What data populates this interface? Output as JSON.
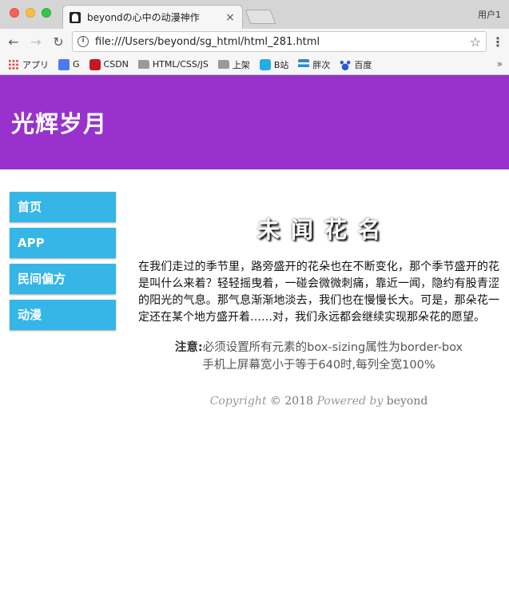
{
  "browser": {
    "tab_title": "beyondの心中の动漫神作",
    "tab_close": "×",
    "user": "用户1",
    "url": "file:///Users/beyond/sg_html/html_281.html",
    "bookmarks": [
      {
        "label": "アプリ",
        "icon": "apps-grid-icon"
      },
      {
        "label": "G",
        "icon": "google-icon"
      },
      {
        "label": "CSDN",
        "icon": "csdn-icon"
      },
      {
        "label": "HTML/CSS/JS",
        "icon": "folder-icon"
      },
      {
        "label": "上架",
        "icon": "folder-icon"
      },
      {
        "label": "B站",
        "icon": "bilibili-icon"
      },
      {
        "label": "胖次",
        "icon": "wave-icon"
      },
      {
        "label": "百度",
        "icon": "baidu-paw-icon"
      }
    ],
    "more": "»"
  },
  "header": {
    "title": "光辉岁月"
  },
  "nav": [
    {
      "label": "首页"
    },
    {
      "label": "APP"
    },
    {
      "label": "民间偏方"
    },
    {
      "label": "动漫"
    }
  ],
  "article": {
    "title": "未闻花名",
    "body": "在我们走过的季节里，路旁盛开的花朵也在不断变化，那个季节盛开的花是叫什么来着？轻轻摇曳着，一碰会微微刺痛，靠近一闻，隐约有股青涩的阳光的气息。那气息渐渐地淡去，我们也在慢慢长大。可是，那朵花一定还在某个地方盛开着……对，我们永远都会继续实现那朵花的愿望。"
  },
  "notes": {
    "label": "注意:",
    "line1": "必须设置所有元素的box-sizing属性为border-box",
    "line2": "手机上屏幕宽小于等于640时,每列全宽100%"
  },
  "footer": {
    "copyright": "Copyright",
    "symbol_year": " © 2018 ",
    "powered": "Powered by",
    "author": " beyond"
  }
}
